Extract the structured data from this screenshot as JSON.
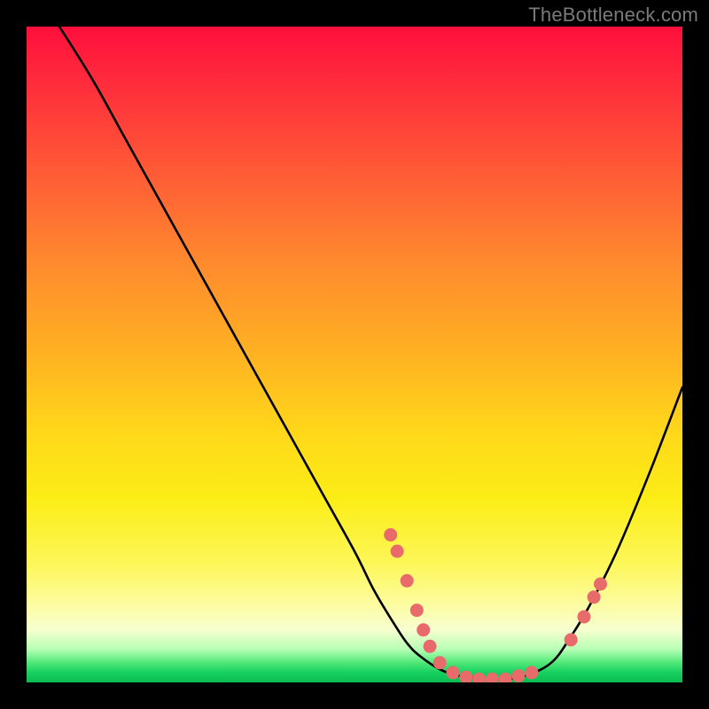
{
  "watermark": "TheBottleneck.com",
  "colors": {
    "background": "#000000",
    "watermark": "#7a7a7a",
    "curve": "#000000",
    "dots": "#e86a6a",
    "gradient_top": "#ff0f3c",
    "gradient_bottom": "#0abb50"
  },
  "chart_data": {
    "type": "line",
    "title": "",
    "xlabel": "",
    "ylabel": "",
    "xlim": [
      0,
      100
    ],
    "ylim": [
      0,
      100
    ],
    "grid": false,
    "legend": false,
    "series": [
      {
        "name": "bottleneck-curve",
        "x": [
          5,
          10,
          15,
          20,
          25,
          30,
          35,
          40,
          45,
          50,
          53,
          56,
          58,
          60,
          63,
          66,
          70,
          73,
          76,
          80,
          83,
          86,
          90,
          95,
          100
        ],
        "y": [
          100,
          92,
          83,
          74,
          65,
          56,
          47,
          38,
          29,
          20,
          14,
          9,
          6,
          4,
          2,
          1,
          0.5,
          0.5,
          1,
          3,
          7,
          12,
          20,
          32,
          45
        ]
      }
    ],
    "dots": [
      {
        "x": 55.5,
        "y": 22.5
      },
      {
        "x": 56.5,
        "y": 20.0
      },
      {
        "x": 58.0,
        "y": 15.5
      },
      {
        "x": 59.5,
        "y": 11.0
      },
      {
        "x": 60.5,
        "y": 8.0
      },
      {
        "x": 61.5,
        "y": 5.5
      },
      {
        "x": 63.0,
        "y": 3.0
      },
      {
        "x": 65.0,
        "y": 1.5
      },
      {
        "x": 67.0,
        "y": 0.8
      },
      {
        "x": 69.0,
        "y": 0.5
      },
      {
        "x": 71.0,
        "y": 0.5
      },
      {
        "x": 73.0,
        "y": 0.5
      },
      {
        "x": 75.0,
        "y": 1.0
      },
      {
        "x": 77.0,
        "y": 1.5
      },
      {
        "x": 83.0,
        "y": 6.5
      },
      {
        "x": 85.0,
        "y": 10.0
      },
      {
        "x": 86.5,
        "y": 13.0
      },
      {
        "x": 87.5,
        "y": 15.0
      }
    ]
  }
}
